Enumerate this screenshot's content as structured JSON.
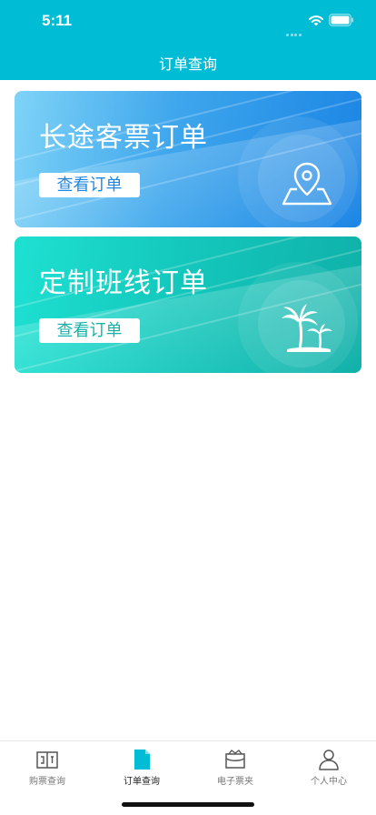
{
  "status_bar": {
    "time": "5:11"
  },
  "nav": {
    "title": "订单查询"
  },
  "cards": [
    {
      "title": "长途客票订单",
      "button": "查看订单",
      "icon": "map-pin-icon"
    },
    {
      "title": "定制班线订单",
      "button": "查看订单",
      "icon": "palm-tree-icon"
    }
  ],
  "tabs": [
    {
      "label": "购票查询",
      "icon": "ticket-book-icon",
      "active": false
    },
    {
      "label": "订单查询",
      "icon": "document-icon",
      "active": true
    },
    {
      "label": "电子票夹",
      "icon": "ticket-folder-icon",
      "active": false
    },
    {
      "label": "个人中心",
      "icon": "person-icon",
      "active": false
    }
  ],
  "colors": {
    "header": "#00bcd4",
    "card1_accent": "#1e88e5",
    "card2_accent": "#12b3a9",
    "tab_active_icon": "#00bcd4"
  }
}
